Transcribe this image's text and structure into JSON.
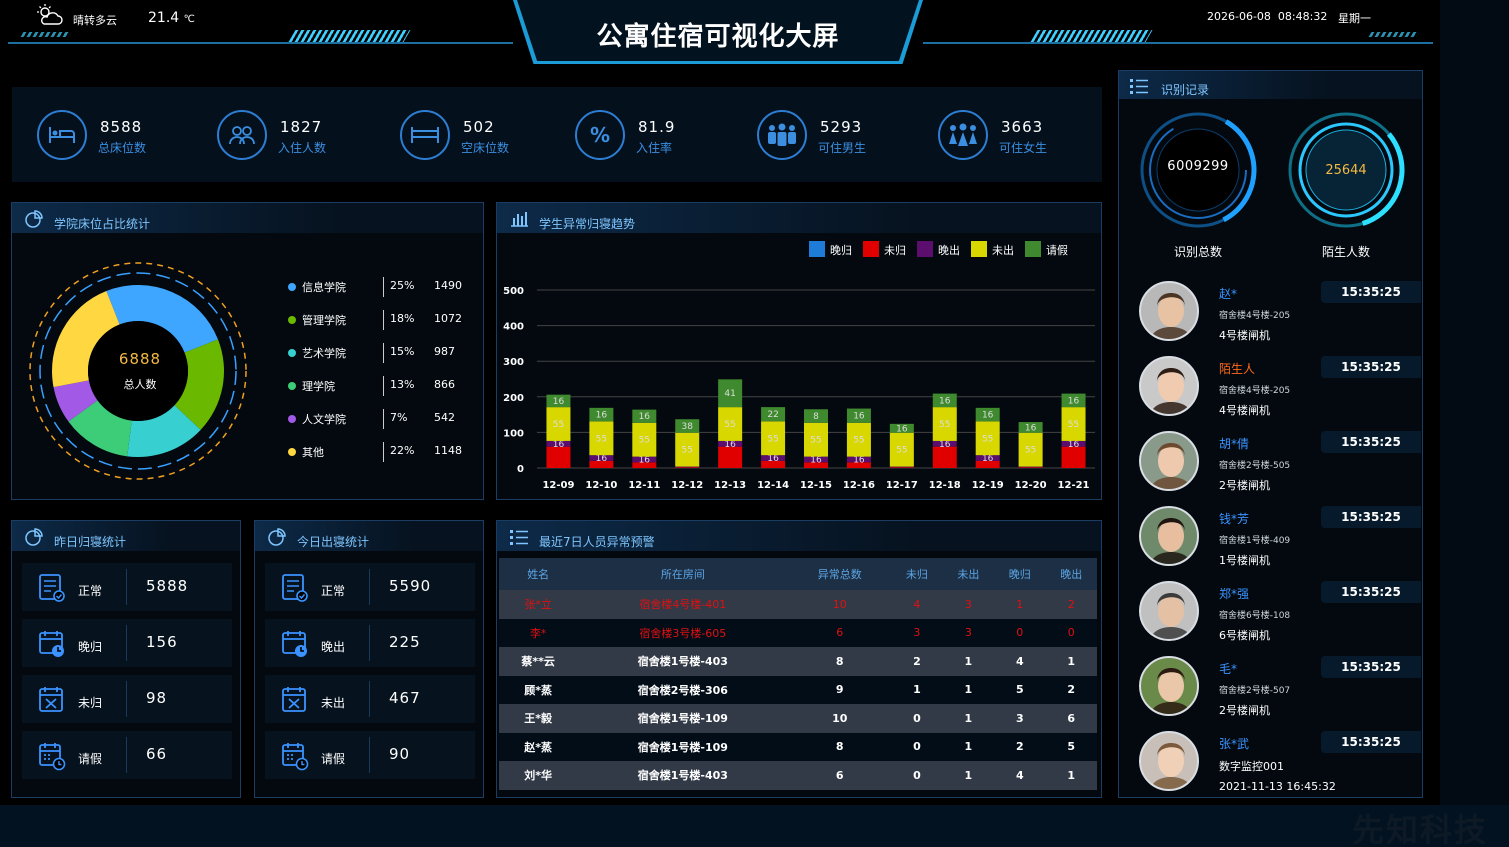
{
  "header": {
    "weather": "晴转多云",
    "temperature": "21.4",
    "temp_unit": "℃",
    "title": "公寓住宿可视化大屏",
    "datetime": "2026-06-08  08:48:32",
    "weekday": "星期一"
  },
  "stats": [
    {
      "value": "8588",
      "label": "总床位数",
      "icon": "bed-icon"
    },
    {
      "value": "1827",
      "label": "入住人数",
      "icon": "people-icon"
    },
    {
      "value": "502",
      "label": "空床位数",
      "icon": "empty-bed-icon"
    },
    {
      "value": "81.9",
      "label": "入住率",
      "icon": "percent-icon"
    },
    {
      "value": "5293",
      "label": "可住男生",
      "icon": "male-group-icon"
    },
    {
      "value": "3663",
      "label": "可住女生",
      "icon": "female-group-icon"
    }
  ],
  "college_panel": {
    "title": "学院床位占比统计",
    "center_value": "6888",
    "center_label": "总人数",
    "items": [
      {
        "name": "信息学院",
        "pct": "25%",
        "count": "1490",
        "color": "#3ea6ff"
      },
      {
        "name": "管理学院",
        "pct": "18%",
        "count": "1072",
        "color": "#6bb800"
      },
      {
        "name": "艺术学院",
        "pct": "15%",
        "count": "987",
        "color": "#37cfcf"
      },
      {
        "name": "理学院",
        "pct": "13%",
        "count": "866",
        "color": "#3dcc78"
      },
      {
        "name": "人文学院",
        "pct": "7%",
        "count": "542",
        "color": "#a25ae6"
      },
      {
        "name": "其他",
        "pct": "22%",
        "count": "1148",
        "color": "#ffd740"
      }
    ]
  },
  "trend_panel": {
    "title": "学生异常归寝趋势"
  },
  "chart_data": {
    "type": "bar",
    "stacked": true,
    "categories": [
      "12-09",
      "12-10",
      "12-11",
      "12-12",
      "12-13",
      "12-14",
      "12-15",
      "12-16",
      "12-17",
      "12-18",
      "12-19",
      "12-20",
      "12-21"
    ],
    "series": [
      {
        "name": "晚归",
        "color": "#1e7bd8",
        "values": [
          0,
          0,
          0,
          0,
          0,
          0,
          0,
          0,
          0,
          0,
          0,
          0,
          0
        ]
      },
      {
        "name": "未归",
        "color": "#e00000",
        "values": [
          60,
          20,
          16,
          2,
          60,
          20,
          16,
          16,
          2,
          60,
          20,
          2,
          60
        ]
      },
      {
        "name": "晚出",
        "color": "#5c0e6e",
        "values": [
          16,
          16,
          16,
          2,
          16,
          16,
          16,
          16,
          2,
          16,
          16,
          2,
          16
        ]
      },
      {
        "name": "未出",
        "color": "#d8d800",
        "values": [
          95,
          95,
          95,
          95,
          95,
          95,
          95,
          95,
          95,
          95,
          95,
          95,
          95
        ]
      },
      {
        "name": "请假",
        "color": "#3f8a2e",
        "values": [
          35,
          38,
          37,
          38,
          78,
          40,
          38,
          40,
          25,
          38,
          38,
          30,
          38
        ]
      }
    ],
    "bar_labels": [
      [
        "",
        "16",
        "55",
        "16"
      ],
      [
        "",
        "16",
        "55",
        "16"
      ],
      [
        "",
        "16",
        "55",
        "16"
      ],
      [
        "",
        "",
        "55",
        "38"
      ],
      [
        "",
        "16",
        "55",
        "41"
      ],
      [
        "",
        "16",
        "55",
        "22"
      ],
      [
        "",
        "16",
        "55",
        "8"
      ],
      [
        "",
        "16",
        "55",
        "16"
      ],
      [
        "",
        "",
        "55",
        "16"
      ],
      [
        "",
        "16",
        "55",
        "16"
      ],
      [
        "",
        "16",
        "55",
        "16"
      ],
      [
        "",
        "",
        "55",
        "16"
      ],
      [
        "",
        "16",
        "55",
        "16"
      ]
    ],
    "ylim": [
      0,
      500
    ],
    "yticks": [
      "500",
      "400",
      "300",
      "200",
      "100",
      "0"
    ],
    "legend_position": "top-right",
    "grid": true
  },
  "yesterday": {
    "title": "昨日归寝统计",
    "rows": [
      {
        "label": "正常",
        "value": "5888",
        "icon": "checklist-icon"
      },
      {
        "label": "晚归",
        "value": "156",
        "icon": "calendar-clock-icon"
      },
      {
        "label": "未归",
        "value": "98",
        "icon": "calendar-x-icon"
      },
      {
        "label": "请假",
        "value": "66",
        "icon": "calendar-leave-icon"
      }
    ]
  },
  "today": {
    "title": "今日出寝统计",
    "rows": [
      {
        "label": "正常",
        "value": "5590",
        "icon": "checklist-icon"
      },
      {
        "label": "晚出",
        "value": "225",
        "icon": "calendar-clock-icon"
      },
      {
        "label": "未出",
        "value": "467",
        "icon": "calendar-x-icon"
      },
      {
        "label": "请假",
        "value": "90",
        "icon": "calendar-leave-icon"
      }
    ]
  },
  "warnings": {
    "title": "最近7日人员异常预警",
    "columns": [
      "姓名",
      "所在房间",
      "异常总数",
      "未归",
      "未出",
      "晚归",
      "晚出"
    ],
    "rows": [
      [
        "张*立",
        "宿舍楼4号楼-401",
        "10",
        "4",
        "3",
        "1",
        "2"
      ],
      [
        "李*",
        "宿舍楼3号楼-605",
        "6",
        "3",
        "3",
        "0",
        "0"
      ],
      [
        "蔡**云",
        "宿舍楼1号楼-403",
        "8",
        "2",
        "1",
        "4",
        "1"
      ],
      [
        "顾*蒸",
        "宿舍楼2号楼-306",
        "9",
        "1",
        "1",
        "5",
        "2"
      ],
      [
        "王*毅",
        "宿舍楼1号楼-109",
        "10",
        "0",
        "1",
        "3",
        "6"
      ],
      [
        "赵*蒸",
        "宿舍楼1号楼-109",
        "8",
        "0",
        "1",
        "2",
        "5"
      ],
      [
        "刘*华",
        "宿舍楼1号楼-403",
        "6",
        "0",
        "1",
        "4",
        "1"
      ]
    ]
  },
  "recognition": {
    "title": "识别记录",
    "total_value": "6009299",
    "total_label": "识别总数",
    "stranger_value": "25644",
    "stranger_label": "陌生人数",
    "records": [
      {
        "name": "赵*",
        "building": "宿舍楼4号楼-205",
        "device": "4号楼闸机",
        "time": "15:35:25"
      },
      {
        "name": "陌生人",
        "building": "宿舍楼4号楼-205",
        "device": "4号楼闸机",
        "time": "15:35:25"
      },
      {
        "name": "胡*倩",
        "building": "宿舍楼2号楼-505",
        "device": "2号楼闸机",
        "time": "15:35:25"
      },
      {
        "name": "钱*芳",
        "building": "宿舍楼1号楼-409",
        "device": "1号楼闸机",
        "time": "15:35:25"
      },
      {
        "name": "郑*强",
        "building": "宿舍楼6号楼-108",
        "device": "6号楼闸机",
        "time": "15:35:25"
      },
      {
        "name": "毛*",
        "building": "宿舍楼2号楼-507",
        "device": "2号楼闸机",
        "time": "15:35:25"
      },
      {
        "name": "张*武",
        "building": "数字监控001",
        "device": "2021-11-13 16:45:32",
        "time": "15:35:25"
      }
    ]
  },
  "watermark": "先知科技"
}
